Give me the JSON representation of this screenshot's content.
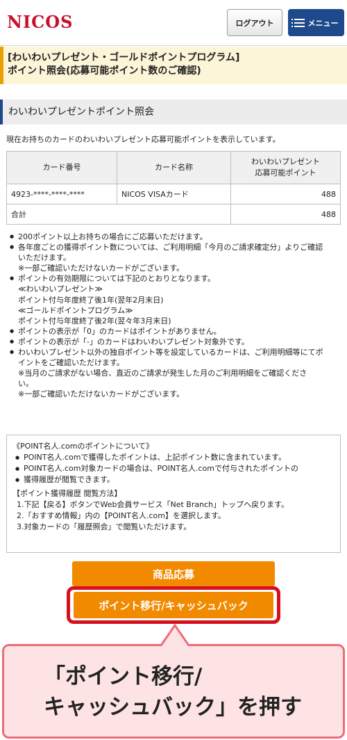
{
  "header": {
    "logo_text": "NICOS",
    "logout_label": "ログアウト",
    "menu_label": "メニュー",
    "brand_color": "#c8102e",
    "menu_color": "#1e4a8c"
  },
  "title": {
    "line1": "[わいわいプレゼント・ゴールドポイントプログラム]",
    "line2": "ポイント照会(応募可能ポイント数のご確認)"
  },
  "section_title": "わいわいプレゼントポイント照会",
  "intro_text": "現在お持ちのカードのわいわいプレゼント応募可能ポイントを表示しています。",
  "table": {
    "headers": [
      "カード番号",
      "カード名称",
      "わいわいプレゼント",
      "応募可能ポイント"
    ],
    "row": {
      "card_number": "4923-****-****-****",
      "card_name": "NICOS VISAカード",
      "points": "488"
    },
    "total": {
      "label": "合計",
      "points": "488"
    }
  },
  "notes": [
    "200ポイント以上お持ちの場合にご応募いただけます。",
    "各年度ごとの獲得ポイント数については、ご利用明細「今月のご請求確定分」よりご確認",
    "いただけます。",
    "※一部ご確認いただけないカードがございます。",
    "ポイントの有効期限については下記のとおりとなります。",
    "≪わいわいプレゼント≫",
    "ポイント付与年度終了後1年(翌年2月末日)",
    "≪ゴールドポイントプログラム≫",
    "ポイント付与年度終了後2年(翌々年3月末日)",
    "ポイントの表示が「0」のカードはポイントがありません。",
    "ポイントの表示が「-」のカードはわいわいプレゼント対象外です。",
    "わいわいプレゼント以外の独自ポイント等を設定しているカードは、ご利用明細等にてポ",
    "イントをご確認いただけます。",
    "※当月のご請求がない場合、直近のご請求が発生した月のご利用明細をご確認くださ",
    "い。",
    "※一部ご確認いただけないカードがございます。"
  ],
  "info_box": {
    "title": "《POINT名人.comのポイントについて》",
    "items": [
      "POINT名人.comで獲得したポイントは、上記ポイント数に含まれています。",
      "POINT名人.com対象カードの場合は、POINT名人.comで付与されたポイントの",
      "獲得履歴が閲覧できます。"
    ],
    "sub_title": "【ポイント獲得履歴 閲覧方法】",
    "steps": [
      "1.下記【戻る】ボタンでWeb会員サービス「Net Branch」トップへ戻ります。",
      "2.「おすすめ情報」内の【POINT名人.com】を選択します。",
      "3.対象カードの「履歴照会」で閲覧いただけます。"
    ]
  },
  "buttons": {
    "apply": "商品応募",
    "transfer": "ポイント移行/キャッシュバック",
    "color": "#f28a00"
  },
  "callout": {
    "line1": "「ポイント移行/",
    "line2": "キャッシュバック」を押す"
  }
}
